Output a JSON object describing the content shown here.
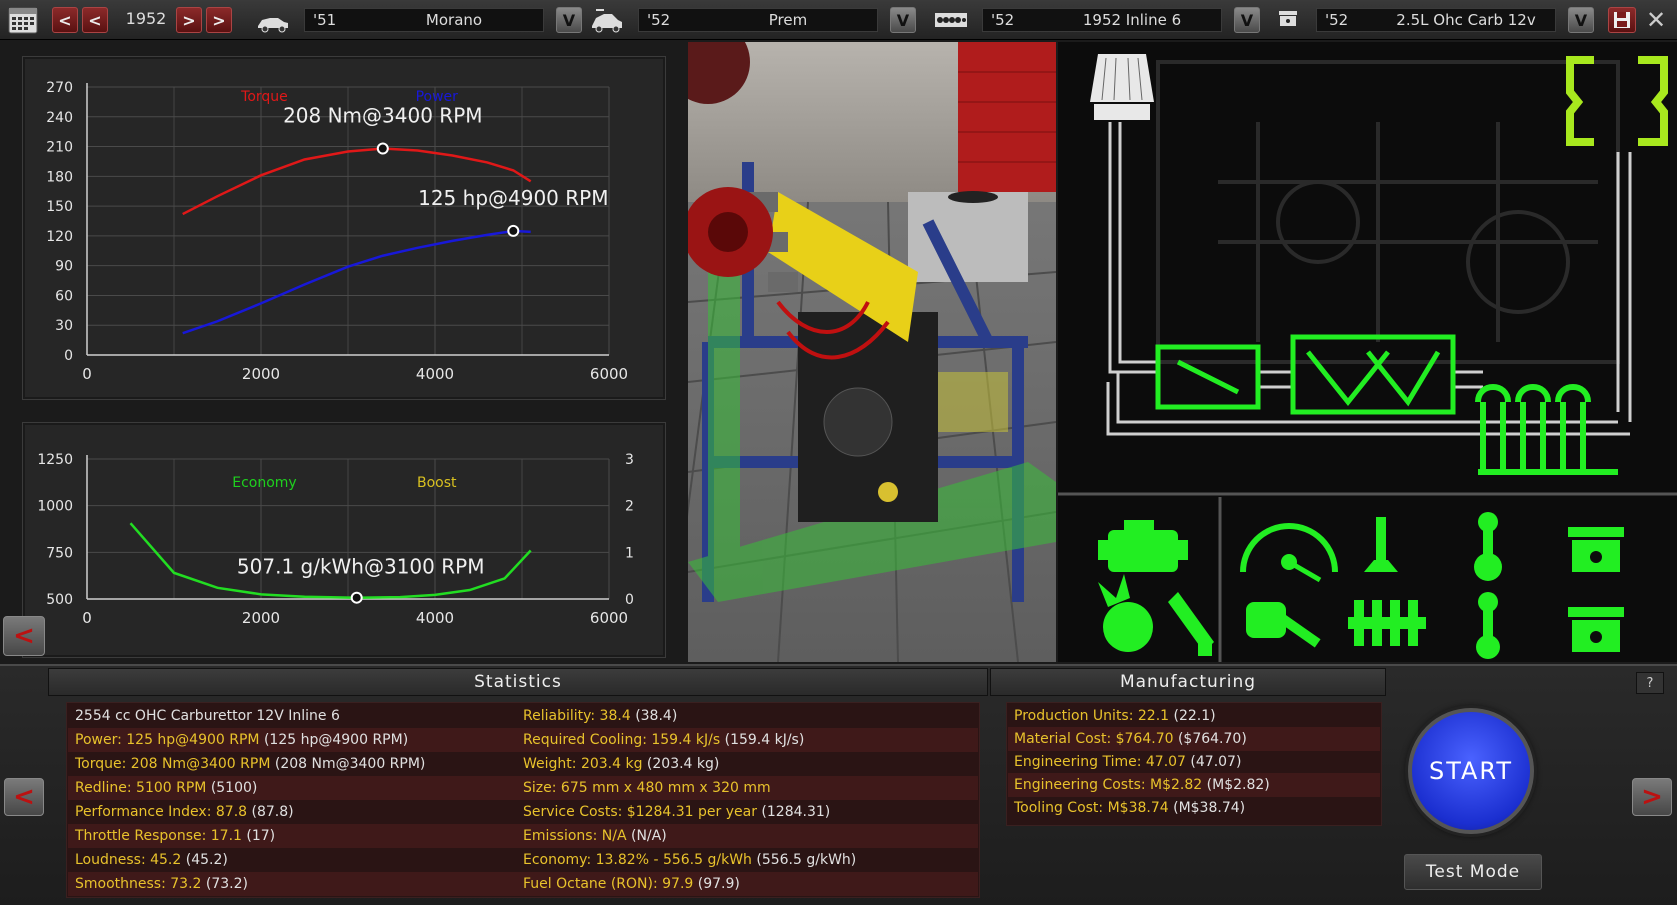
{
  "toolbar": {
    "year": "1952",
    "prev_label": "<",
    "next_label": ">",
    "dropdown_label": "V",
    "selectors": [
      {
        "year": "'51",
        "name": "Morano",
        "icon": "car-body-icon"
      },
      {
        "year": "'52",
        "name": "Prem",
        "icon": "car-model-icon"
      },
      {
        "year": "'52",
        "name": "1952 Inline 6",
        "icon": "engine-block-icon"
      },
      {
        "year": "'52",
        "name": "2.5L Ohc Carb 12v",
        "icon": "piston-icon"
      }
    ],
    "icons": [
      "calendar-icon",
      "save-icon",
      "close-icon"
    ]
  },
  "chart_data": [
    {
      "type": "line",
      "title": "",
      "xlabel": "",
      "ylabel": "",
      "xlim": [
        0,
        6000
      ],
      "ylim": [
        0,
        270
      ],
      "xticks": [
        0,
        2000,
        4000,
        6000
      ],
      "yticks": [
        0,
        30,
        60,
        90,
        120,
        150,
        180,
        210,
        240,
        270
      ],
      "grid": true,
      "legend": [
        "Torque",
        "Power"
      ],
      "series": [
        {
          "name": "Torque",
          "color": "#e01818",
          "x": [
            1100,
            1500,
            2000,
            2500,
            3000,
            3400,
            3800,
            4200,
            4600,
            4900,
            5100
          ],
          "y": [
            142,
            160,
            181,
            197,
            205,
            208,
            206,
            201,
            194,
            186,
            175
          ]
        },
        {
          "name": "Power",
          "color": "#1818d8",
          "x": [
            1100,
            1500,
            2000,
            2500,
            3000,
            3400,
            3800,
            4200,
            4600,
            4900,
            5100
          ],
          "y": [
            22,
            34,
            52,
            71,
            89,
            100,
            108,
            115,
            121,
            125,
            124
          ]
        }
      ],
      "annotations": [
        {
          "text": "208 Nm@3400 RPM",
          "x": 3400,
          "y": 208
        },
        {
          "text": "125 hp@4900 RPM",
          "x": 4900,
          "y": 125
        }
      ]
    },
    {
      "type": "line",
      "title": "",
      "xlim": [
        0,
        6000
      ],
      "ylim": [
        500,
        1250
      ],
      "y2lim": [
        0,
        3
      ],
      "xticks": [
        0,
        2000,
        4000,
        6000
      ],
      "yticks": [
        500,
        750,
        1000,
        1250
      ],
      "y2ticks": [
        0,
        1,
        2,
        3
      ],
      "grid": true,
      "legend": [
        "Economy",
        "Boost"
      ],
      "legend_colors": [
        "#1ed01e",
        "#d8c020"
      ],
      "series": [
        {
          "name": "Economy",
          "color": "#22dd22",
          "x": [
            500,
            1000,
            1500,
            2000,
            2500,
            3100,
            3600,
            4000,
            4400,
            4800,
            5100
          ],
          "y": [
            906,
            640,
            560,
            525,
            512,
            507,
            510,
            522,
            548,
            610,
            760
          ]
        }
      ],
      "annotations": [
        {
          "text": "507.1 g/kWh@3100 RPM",
          "x": 3100,
          "y": 507
        }
      ]
    }
  ],
  "statistics": {
    "title": "Statistics",
    "left": [
      {
        "plain": "2554 cc OHC Carburettor 12V Inline 6"
      },
      {
        "k": "Power: 125 hp@4900 RPM",
        "v": "(125 hp@4900 RPM)"
      },
      {
        "k": "Torque: 208 Nm@3400 RPM",
        "v": "(208 Nm@3400 RPM)"
      },
      {
        "k": "Redline: 5100 RPM",
        "v": "(5100)"
      },
      {
        "k": "Performance Index: 87.8",
        "v": "(87.8)"
      },
      {
        "k": "Throttle Response: 17.1",
        "v": "(17)"
      },
      {
        "k": "Loudness: 45.2",
        "v": "(45.2)"
      },
      {
        "k": "Smoothness: 73.2",
        "v": "(73.2)"
      }
    ],
    "right": [
      {
        "k": "Reliability: 38.4",
        "v": "(38.4)"
      },
      {
        "k": "Required Cooling: 159.4 kJ/s",
        "v": "(159.4 kJ/s)"
      },
      {
        "k": "Weight: 203.4 kg",
        "v": "(203.4 kg)"
      },
      {
        "k": "Size: 675 mm x 480 mm x 320 mm",
        "v": ""
      },
      {
        "k": "Service Costs: $1284.31 per year",
        "v": "(1284.31)"
      },
      {
        "k": "Emissions: N/A",
        "v": "(N/A)"
      },
      {
        "k": "Economy: 13.82% - 556.5 g/kWh",
        "v": "(556.5 g/kWh)"
      },
      {
        "k": "Fuel Octane (RON): 97.9",
        "v": "(97.9)"
      }
    ]
  },
  "manufacturing": {
    "title": "Manufacturing",
    "rows": [
      {
        "k": "Production Units: 22.1",
        "v": "(22.1)"
      },
      {
        "k": "Material Cost: $764.70",
        "v": "($764.70)"
      },
      {
        "k": "Engineering Time: 47.07",
        "v": "(47.07)"
      },
      {
        "k": "Engineering Costs: M$2.82",
        "v": "(M$2.82)"
      },
      {
        "k": "Tooling Cost: M$38.74",
        "v": "(M$38.74)"
      }
    ]
  },
  "actions": {
    "start_label": "START",
    "test_mode_label": "Test Mode",
    "help_label": "?",
    "back_label": "<",
    "forward_label": ">"
  },
  "part_icons": [
    "air-intake-icon",
    "exhaust-icon",
    "engine-icon",
    "gauge-icon",
    "valve-icon",
    "conrod-icon",
    "piston-icon",
    "ignition-icon",
    "spark-plug-icon",
    "wrench-fist-icon",
    "crankshaft-icon",
    "conrod-icon-2",
    "piston-icon-2"
  ],
  "colors": {
    "accent_green": "#22ee22",
    "label_yellow": "#e8c22c",
    "torque": "#e01818",
    "power": "#1818d8"
  }
}
